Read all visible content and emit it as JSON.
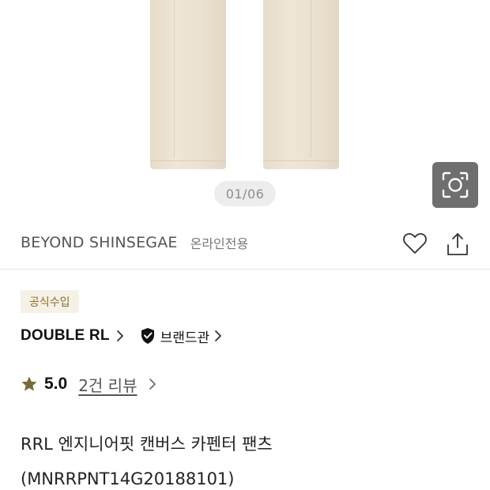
{
  "gallery": {
    "counter": "01/06",
    "lens_icon": "camera-lens-icon"
  },
  "store": {
    "name": "BEYOND SHINSEGAE",
    "tag": "온라인전용"
  },
  "actions": {
    "wishlist_icon": "heart-icon",
    "share_icon": "share-icon"
  },
  "badge": {
    "label": "공식수입"
  },
  "brand": {
    "name": "DOUBLE RL",
    "shop_label": "브랜드관",
    "shop_icon": "shield-check-icon"
  },
  "rating": {
    "value": "5.0",
    "review_link": "2건 리뷰",
    "star_color": "#7a6a3c"
  },
  "product": {
    "title": "RRL 엔지니어핏 캔버스 카펜터 팬츠(MNRRPNT14G20188101)"
  },
  "colors": {
    "badge_bg": "#f5f1e6",
    "badge_text": "#8a6d2c",
    "lens_button_bg": "#6f6f6f"
  }
}
